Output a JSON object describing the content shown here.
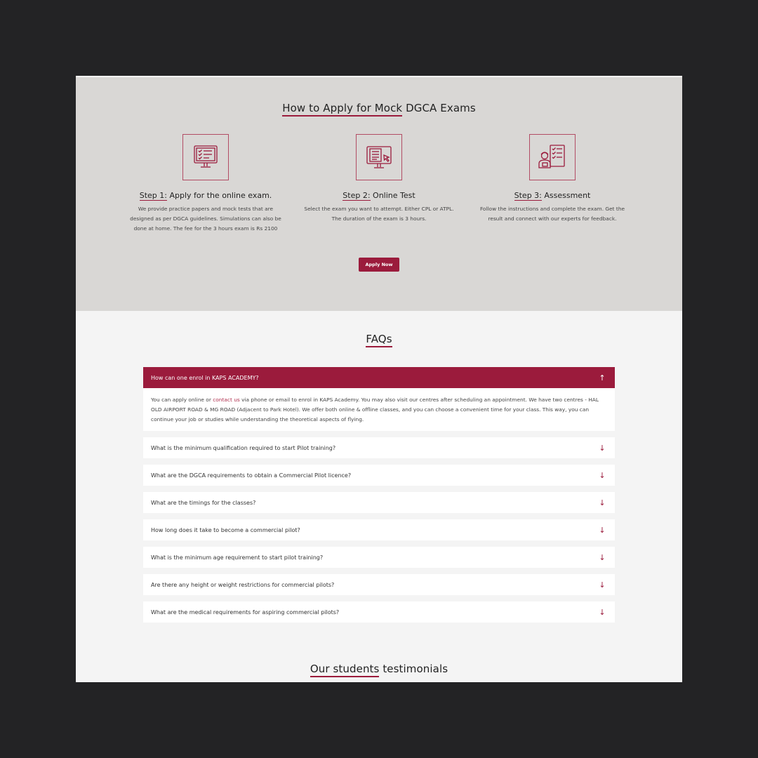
{
  "apply": {
    "title_part1": "How to Apply for Mock",
    "title_part2": "DGCA Exams",
    "steps": [
      {
        "num": "Step 1:",
        "title": "Apply for the online exam.",
        "desc": "We provide practice papers and mock tests that are designed as per DGCA guidelines. Simulations can also be done at home. The fee for the 3 hours exam is Rs 2100",
        "icon": "laptop-checklist-icon"
      },
      {
        "num": "Step 2:",
        "title": "Online Test",
        "desc": "Select the exam you want to attempt. Either CPL or ATPL. The duration of the exam is 3 hours.",
        "icon": "monitor-cursor-icon"
      },
      {
        "num": "Step 3:",
        "title": "Assessment",
        "desc": "Follow the instructions and complete the exam. Get the result and connect with our experts for feedback.",
        "icon": "examiner-checklist-icon"
      }
    ],
    "button_label": "Apply Now"
  },
  "faq": {
    "title": "FAQs",
    "open_item": {
      "question": "How can one enrol in KAPS ACADEMY?",
      "answer_before": "You can apply online or ",
      "answer_link": "contact us",
      "answer_after": " via phone or email to enrol in KAPS Academy. You may also visit our centres after scheduling an appointment. We have two centres - HAL OLD AIRPORT ROAD & MG ROAD (Adjacent to Park Hotel). We offer both online & offline classes, and you can choose a convenient time for your class. This way, you can continue your job or studies while understanding the theoretical aspects of flying."
    },
    "items": [
      "What is the minimum qualification required to start Pilot training?",
      "What are the DGCA requirements to obtain a Commercial Pilot licence?",
      "What are the timings for the classes?",
      "How long does it take to become a commercial pilot?",
      "What is the minimum age requirement to start pilot training?",
      "Are there any height or weight restrictions for commercial pilots?",
      "What are the medical requirements for aspiring commercial pilots?"
    ],
    "arrow_up": "↑",
    "arrow_down": "↓"
  },
  "testimonials": {
    "title_part1": "Our students",
    "title_part2": "testimonials"
  },
  "colors": {
    "accent": "#9b1b3c",
    "page_bg": "#232325",
    "apply_bg": "#d9d7d5",
    "faq_bg": "#f4f4f4"
  }
}
